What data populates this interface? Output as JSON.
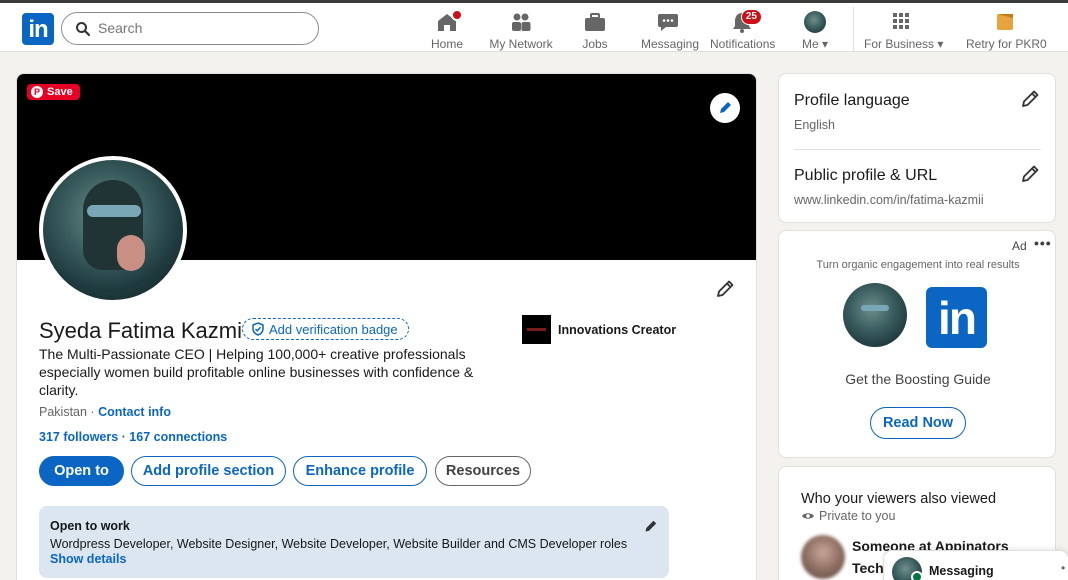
{
  "nav": {
    "search_placeholder": "Search",
    "items": [
      {
        "label": "Home",
        "icon": "home-icon"
      },
      {
        "label": "My Network",
        "icon": "people-icon"
      },
      {
        "label": "Jobs",
        "icon": "briefcase-icon"
      },
      {
        "label": "Messaging",
        "icon": "chat-icon"
      },
      {
        "label": "Notifications",
        "icon": "bell-icon",
        "badge": "25"
      },
      {
        "label": "Me",
        "icon": "avatar"
      },
      {
        "label": "For Business",
        "icon": "grid-icon"
      },
      {
        "label": "Retry for PKR0",
        "icon": "premium-icon"
      }
    ]
  },
  "profile": {
    "save_label": "Save",
    "name": "Syeda Fatima Kazmi",
    "verify_label": "Add verification badge",
    "headline": "The Multi-Passionate CEO | Helping 100,000+ creative professionals especially women build profitable online businesses with confidence & clarity.",
    "location": "Pakistan",
    "location_sep": " · ",
    "contact_info": "Contact info",
    "followers": "317 followers",
    "connections": " · 167 connections",
    "company": "Innovations Creator",
    "buttons": {
      "open_to": "Open to",
      "add_section": "Add profile section",
      "enhance": "Enhance profile",
      "resources": "Resources"
    },
    "open_to_work": {
      "title": "Open to work",
      "roles": "Wordpress Developer, Website Designer, Website Developer, Website Builder and CMS Developer roles",
      "show_details": "Show details"
    }
  },
  "sidebar": {
    "profile_language": {
      "title": "Profile language",
      "value": "English"
    },
    "public_profile": {
      "title": "Public profile & URL",
      "value": "www.linkedin.com/in/fatima-kazmii"
    },
    "ad": {
      "label": "Ad",
      "tagline": "Turn organic engagement into real results",
      "guide": "Get the Boosting Guide",
      "button": "Read Now",
      "logo_text": "in"
    },
    "viewers": {
      "title": "Who your viewers also viewed",
      "private": "Private to you",
      "name_line1": "Someone at Appinators",
      "name_line2": "Techi"
    }
  },
  "messaging": {
    "label": "Messaging"
  },
  "colors": {
    "brand": "#0a66c2",
    "badge": "#cc1016",
    "otw_bg": "#dce6f1"
  }
}
